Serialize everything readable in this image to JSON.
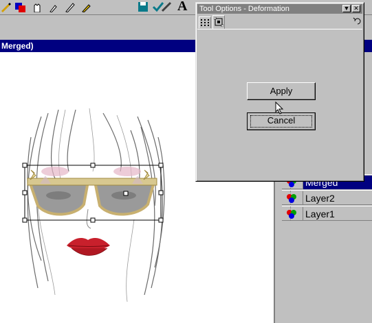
{
  "toolbar": {
    "icons": [
      "paint-icon",
      "color-icon",
      "hand-icon",
      "dropper-icon",
      "pen-icon",
      "brush-icon",
      "save-icon",
      "check-icon",
      "text-tool-icon"
    ],
    "text_tool_glyph": "A"
  },
  "document": {
    "title": "Merged)"
  },
  "dialog": {
    "title": "Tool Options - Deformation",
    "minimize_glyph": "▼",
    "close_glyph": "✕",
    "tabs": [
      "grid-tab",
      "deformation-tab"
    ],
    "apply_label": "Apply",
    "cancel_label": "Cancel"
  },
  "layers": {
    "items": [
      {
        "name": "Merged",
        "selected": true
      },
      {
        "name": "Layer2",
        "selected": false
      },
      {
        "name": "Layer1",
        "selected": false
      }
    ]
  },
  "colors": {
    "title_active": "#000080",
    "title_inactive": "#808080",
    "face": "#c0c0c0"
  }
}
